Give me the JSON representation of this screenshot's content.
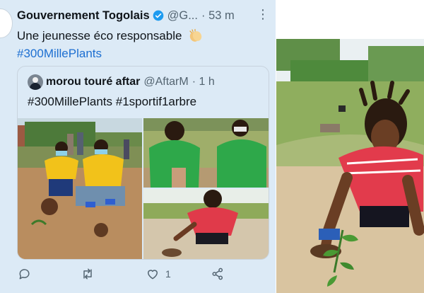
{
  "tweet": {
    "author_name": "Gouvernement Togolais",
    "handle": "@G...",
    "time": "· 53 m",
    "text": "Une jeunesse éco responsable",
    "hashtag": "#300MillePlants"
  },
  "quoted_tweet": {
    "author_name": "morou touré aftar",
    "handle": "@AftarM",
    "time": "· 1 h",
    "text": "#300MillePlants #1sportif1arbre"
  },
  "actions": {
    "like_count": "1"
  },
  "colors": {
    "panel_bg": "#dceaf6",
    "link": "#1d6fd1",
    "verified": "#1d9bf0",
    "muted": "#536471"
  },
  "icons": [
    "verified-badge-icon",
    "clapping-hands-emoji",
    "more-options-icon",
    "reply-icon",
    "retweet-icon",
    "like-icon",
    "share-icon"
  ]
}
